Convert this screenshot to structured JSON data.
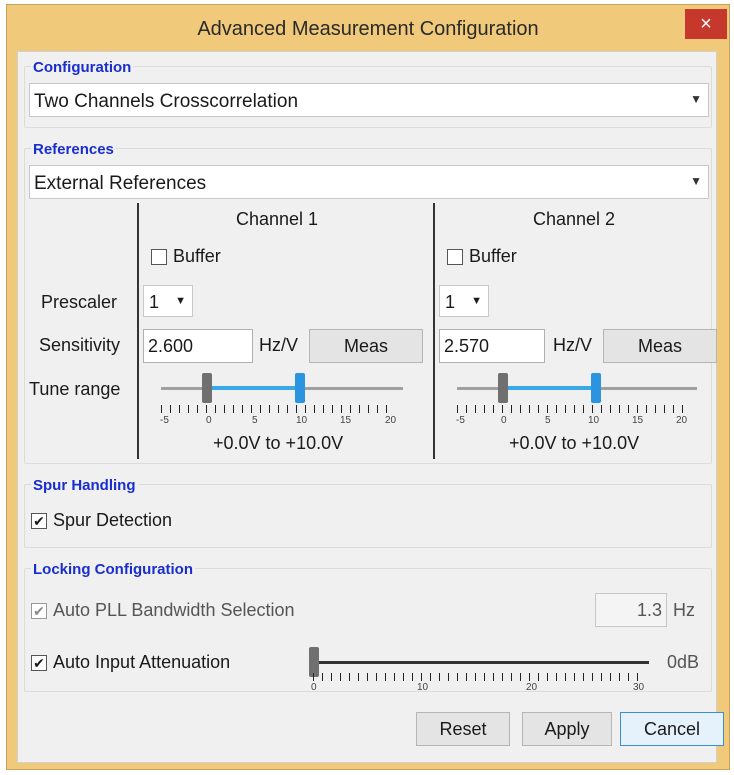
{
  "window": {
    "title": "Advanced Measurement Configuration",
    "close_label": "×"
  },
  "configuration": {
    "title": "Configuration",
    "selected": "Two Channels Crosscorrelation"
  },
  "references": {
    "title": "References",
    "selected": "External References",
    "row_labels": {
      "prescaler": "Prescaler",
      "sensitivity": "Sensitivity",
      "tune_range": "Tune range"
    },
    "channels": [
      {
        "name": "Channel 1",
        "buffer_label": "Buffer",
        "buffer_checked": false,
        "prescaler": "1",
        "sensitivity": "2.600",
        "unit": "Hz/V",
        "meas_label": "Meas",
        "tune_min": 0,
        "tune_max": 10,
        "scale_labels": [
          "-5",
          "0",
          "5",
          "10",
          "15",
          "20"
        ],
        "range_text": "+0.0V to +10.0V"
      },
      {
        "name": "Channel 2",
        "buffer_label": "Buffer",
        "buffer_checked": false,
        "prescaler": "1",
        "sensitivity": "2.570",
        "unit": "Hz/V",
        "meas_label": "Meas",
        "tune_min": 0,
        "tune_max": 10,
        "scale_labels": [
          "-5",
          "0",
          "5",
          "10",
          "15",
          "20"
        ],
        "range_text": "+0.0V to +10.0V"
      }
    ]
  },
  "spur": {
    "title": "Spur Handling",
    "detection_label": "Spur Detection",
    "detection_checked": true
  },
  "locking": {
    "title": "Locking Configuration",
    "auto_pll_label": "Auto PLL Bandwidth Selection",
    "auto_pll_checked": true,
    "auto_pll_enabled": false,
    "bandwidth_value": "1.3",
    "bandwidth_unit": "Hz",
    "auto_atten_label": "Auto Input Attenuation",
    "auto_atten_checked": true,
    "atten_value": 0,
    "atten_scale_labels": [
      "0",
      "10",
      "20",
      "30"
    ],
    "atten_readout": "0dB"
  },
  "buttons": {
    "reset": "Reset",
    "apply": "Apply",
    "cancel": "Cancel"
  },
  "icons": {
    "check": "✔",
    "dropdown": "⌄"
  }
}
